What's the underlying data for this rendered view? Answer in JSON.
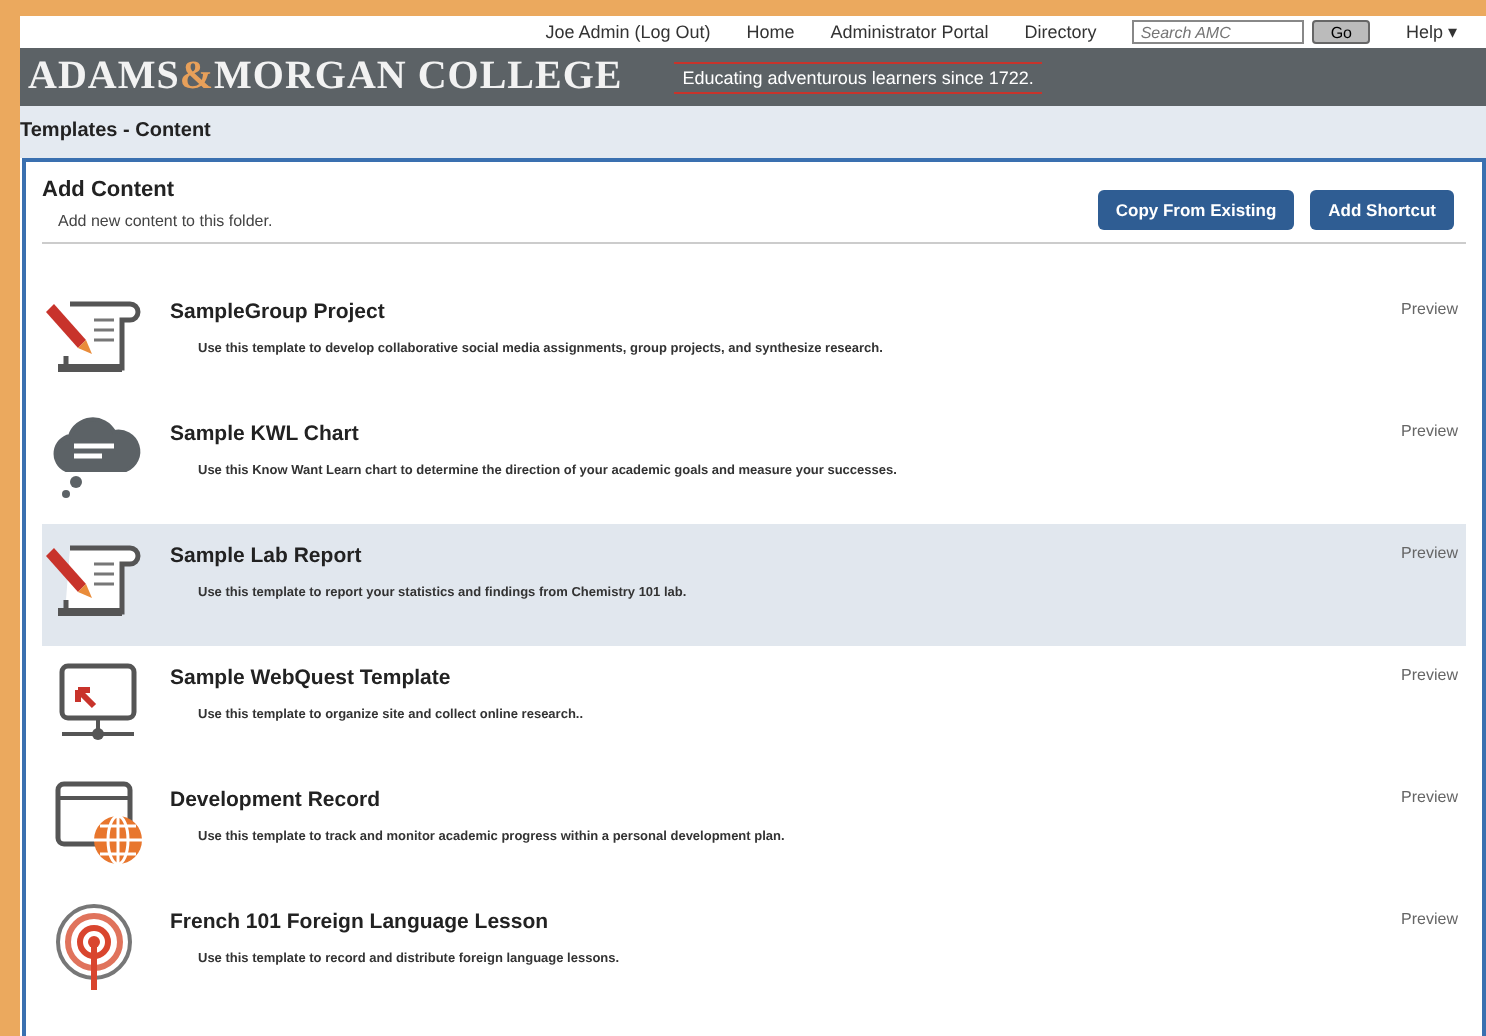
{
  "top_nav": {
    "user": "Joe Admin (Log Out)",
    "links": [
      "Home",
      "Administrator Portal",
      "Directory"
    ],
    "search": {
      "placeholder": "Search AMC"
    },
    "go_button": "Go",
    "help": "Help ▾"
  },
  "banner": {
    "logo_left": "ADAMS",
    "logo_amp": "&",
    "logo_right": "MORGAN COLLEGE",
    "tagline": "Educating adventurous learners since 1722."
  },
  "breadcrumb": "Templates - Content",
  "panel": {
    "title": "Add Content",
    "subtitle": "Add new content to this folder.",
    "buttons": [
      "Copy From Existing",
      "Add Shortcut"
    ]
  },
  "templates": [
    {
      "kind": "scroll",
      "title": "SampleGroup Project",
      "description": "Use this template to develop collaborative social media assignments, group projects, and synthesize research.",
      "action": "Preview",
      "selected": false
    },
    {
      "kind": "cloud",
      "title": "Sample KWL Chart",
      "description": "Use this Know Want Learn chart to determine the direction of your academic goals and measure your successes.",
      "action": "Preview",
      "selected": false
    },
    {
      "kind": "scroll",
      "title": "Sample Lab Report",
      "description": "Use this template to report your statistics and findings from Chemistry 101 lab.",
      "action": "Preview",
      "selected": true
    },
    {
      "kind": "monitor",
      "title": "Sample WebQuest Template",
      "description": "Use this template to organize site and collect online research..",
      "action": "Preview",
      "selected": false
    },
    {
      "kind": "globe",
      "title": "Development Record",
      "description": "Use this template to track and monitor academic progress within a personal development plan.",
      "action": "Preview",
      "selected": false
    },
    {
      "kind": "podcast",
      "title": "French 101 Foreign Language Lesson",
      "description": "Use this template to record and distribute foreign language lessons.",
      "action": "Preview",
      "selected": false
    }
  ]
}
